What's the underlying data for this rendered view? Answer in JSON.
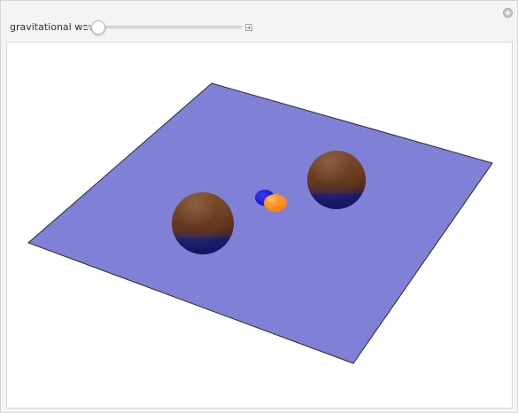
{
  "controls": {
    "slider_label": "gravitational waves",
    "slider_value_fraction": 0.1
  },
  "scene": {
    "plane_color": "#7f80d6",
    "plane_edge_color": "#2a2a2a",
    "sphere_top_color": "#6a3b1d",
    "sphere_bottom_color": "#1d1d73",
    "center_blue_color": "#1515d8",
    "center_orange_color": "#ff8a18"
  }
}
